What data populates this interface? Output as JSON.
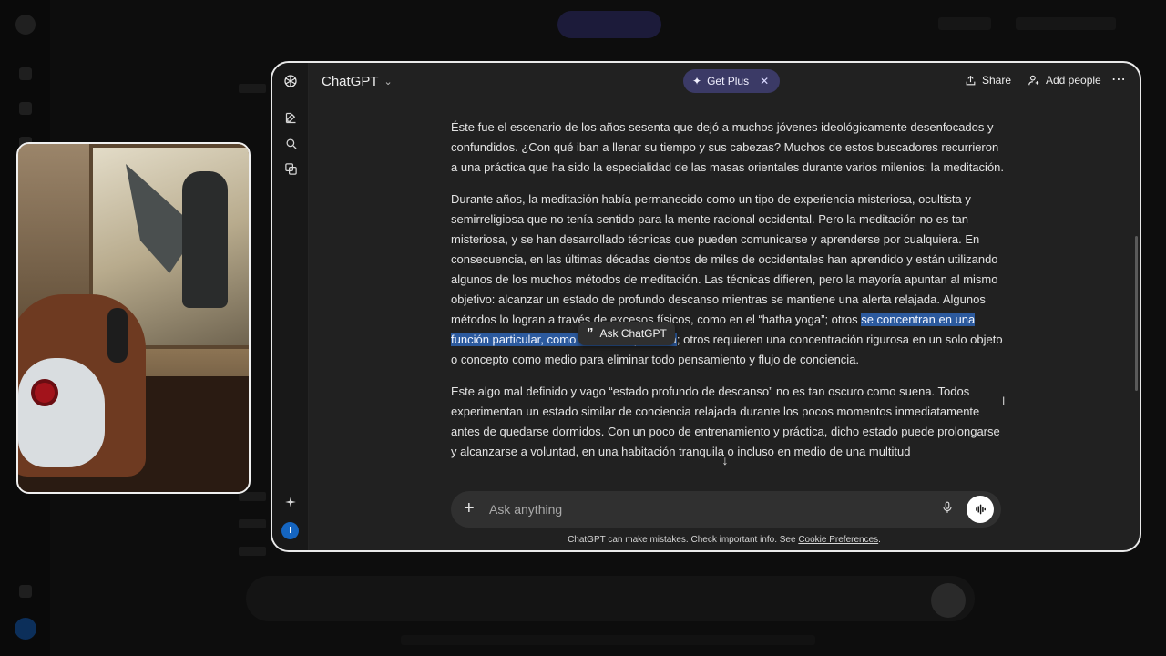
{
  "window": {
    "app_title": "ChatGPT",
    "get_plus_label": "Get Plus",
    "share_label": "Share",
    "add_people_label": "Add people",
    "more_icon": "ellipsis-icon"
  },
  "rail": {
    "items": [
      {
        "name": "new-chat-icon"
      },
      {
        "name": "search-icon"
      },
      {
        "name": "library-icon"
      }
    ],
    "sparkle_icon": "sparkle-icon",
    "avatar_initial": "I"
  },
  "content": {
    "paragraphs": [
      "Éste fue el escenario de los años sesenta que dejó a muchos jóvenes ideológicamente desenfocados y confundidos. ¿Con qué iban a llenar su tiempo y sus cabezas? Muchos de estos buscadores recurrieron a una práctica que ha sido la especialidad de las masas orientales durante varios milenios: la meditación.",
      "Este algo mal definido y vago “estado profundo de descanso” no es tan oscuro como suena. Todos experimentan un estado similar de conciencia relajada durante los pocos momentos inmediatamente antes de quedarse dormidos. Con un poco de entrenamiento y práctica, dicho estado puede prolongarse y alcanzarse a voluntad, en una habitación tranquila o incluso en medio de una multitud"
    ],
    "p2_before": "Durante años, la meditación había permanecido como un tipo de experiencia misteriosa, ocultista y semirreligiosa que no tenía sentido para la mente racional occidental. Pero la meditación no es tan misteriosa, y se han desarrollado técnicas que pueden comunicarse y aprenderse por cualquiera. En consecuencia, en las últimas décadas cientos de miles de occidentales han aprendido y están utilizando algunos de los muchos métodos de meditación. Las técnicas difieren, pero la mayoría apuntan al mismo objetivo: alcanzar un estado de profundo descanso mientras se mantiene una alerta relajada. Algunos métodos lo logran a través de excesos físicos, como en el “hatha yoga”; otros ",
    "p2_highlight": "se concentran en una función particular, como la tasa respiratoria",
    "p2_after": "; otros requieren una concentración rigurosa en un solo objeto o concepto como medio para eliminar todo pensamiento y flujo de conciencia.",
    "ask_popup_label": "Ask ChatGPT"
  },
  "composer": {
    "placeholder": "Ask anything",
    "plus_icon": "plus-icon",
    "mic_icon": "mic-icon",
    "voice_icon": "voice-mode-icon"
  },
  "footer": {
    "text": "ChatGPT can make mistakes. Check important info. See ",
    "link": "Cookie Preferences",
    "end": "."
  }
}
